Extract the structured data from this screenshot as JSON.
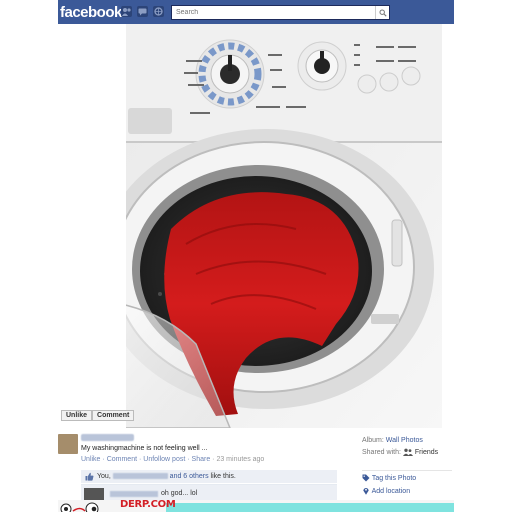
{
  "topbar": {
    "logo": "facebook",
    "search_placeholder": "Search"
  },
  "photo": {
    "unlike_label": "Unlike",
    "comment_label": "Comment"
  },
  "post": {
    "status_text": "My washingmachine is not feeling well ...",
    "actions": {
      "unlike": "Unlike",
      "sep1": " · ",
      "comment": "Comment",
      "sep2": " · ",
      "unfollow": "Unfollow post",
      "sep3": " · ",
      "share": "Share",
      "sep4": " · ",
      "time": "23 minutes ago"
    },
    "likes": {
      "prefix": "You,",
      "others": "and 6 others",
      "suffix": "like this."
    },
    "comment_text": "oh god... lol"
  },
  "side": {
    "album_label": "Album:",
    "album_value": "Wall Photos",
    "shared_label": "Shared with:",
    "shared_value": "Friends",
    "tag_photo": "Tag this Photo",
    "add_location": "Add location"
  },
  "watermark": {
    "text": "DERP.COM"
  },
  "colors": {
    "brand": "#3b5998",
    "link": "#3b5998",
    "accent_red": "#d31f26"
  }
}
